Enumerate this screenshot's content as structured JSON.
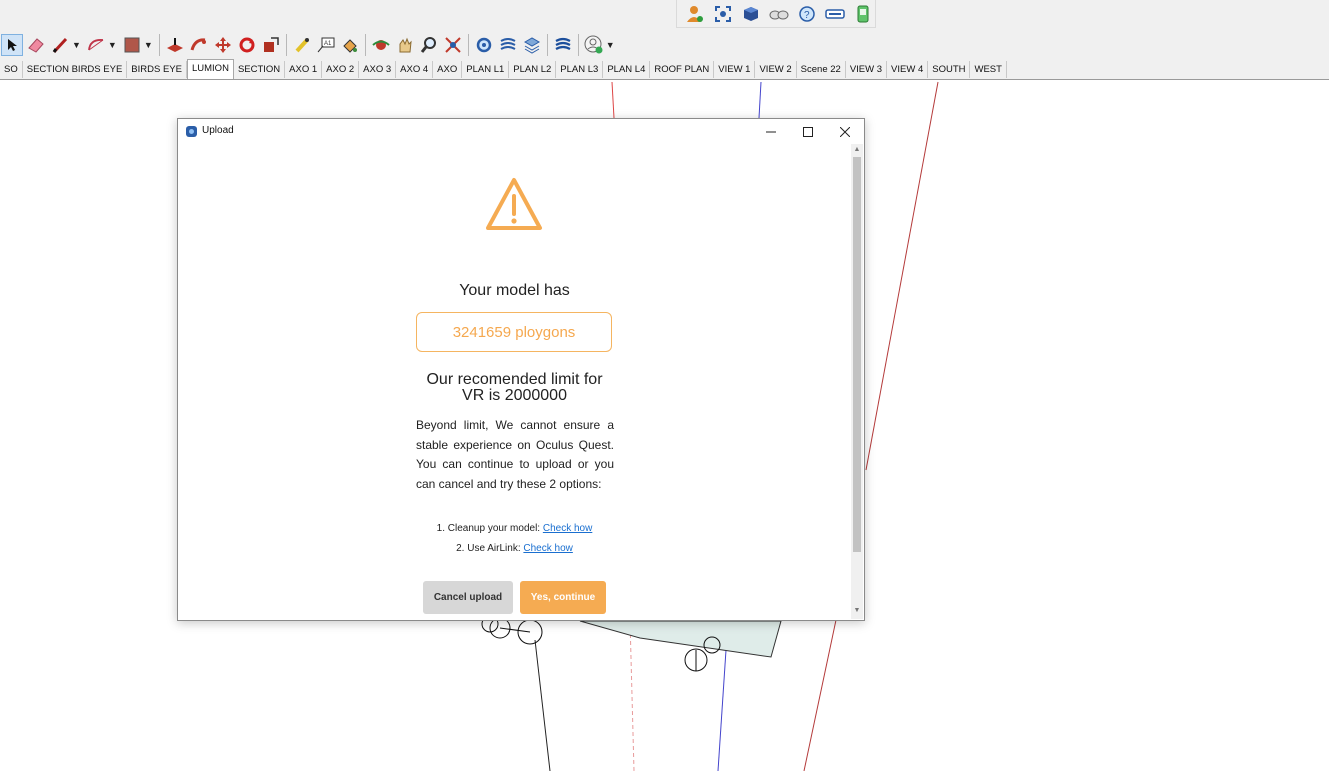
{
  "toolbar": {
    "scene_tabs": [
      "SO",
      "SECTION BIRDS EYE",
      "BIRDS EYE",
      "LUMION",
      "SECTION",
      "AXO 1",
      "AXO 2",
      "AXO 3",
      "AXO 4",
      "AXO",
      "PLAN L1",
      "PLAN L2",
      "PLAN L3",
      "PLAN L4",
      "ROOF PLAN",
      "VIEW 1",
      "VIEW 2",
      "Scene 22",
      "VIEW 3",
      "VIEW 4",
      "SOUTH",
      "WEST"
    ],
    "active_scene": "LUMION"
  },
  "dialog": {
    "title": "Upload",
    "heading": "Your model has",
    "polygon_count": "3241659 ploygons",
    "limit_line1": "Our recomended limit for",
    "limit_line2": "VR is 2000000",
    "beyond_text": "Beyond limit, We cannot ensure a stable experience on Oculus Quest. You can continue to upload or you can cancel and try these 2 options:",
    "option1_text": "1. Cleanup your model:",
    "option1_link": "Check how",
    "option2_text": "2. Use AirLink:",
    "option2_link": "Check how",
    "cancel_label": "Cancel upload",
    "continue_label": "Yes, continue"
  },
  "colors": {
    "accent_orange": "#f5ab52",
    "link_blue": "#1a6fd0",
    "cancel_gray": "#d7d7d7"
  }
}
